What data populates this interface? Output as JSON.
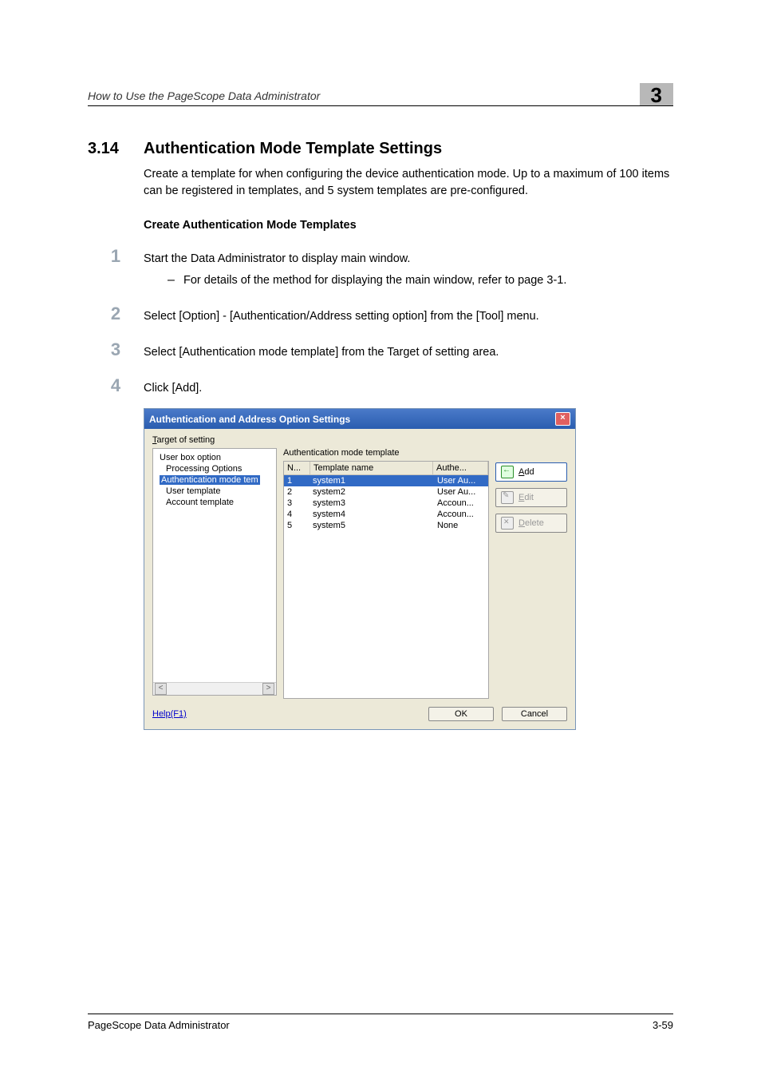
{
  "header": {
    "running_head": "How to Use the PageScope Data Administrator",
    "chapter_number": "3"
  },
  "section": {
    "number": "3.14",
    "title": "Authentication Mode Template Settings",
    "intro": "Create a template for when configuring the device authentication mode. Up to a maximum of 100 items can be registered in templates, and 5 system templates are pre-configured.",
    "sub_heading": "Create Authentication Mode Templates",
    "steps": [
      {
        "num": "1",
        "text": "Start the Data Administrator to display main window.",
        "sub": "For details of the method for displaying the main window, refer to page 3-1."
      },
      {
        "num": "2",
        "text": "Select [Option] - [Authentication/Address setting option] from the [Tool] menu."
      },
      {
        "num": "3",
        "text": "Select [Authentication mode template] from the Target of setting area."
      },
      {
        "num": "4",
        "text": "Click [Add]."
      }
    ]
  },
  "dialog": {
    "title": "Authentication and Address Option Settings",
    "target_label_prefix": "T",
    "target_label_rest": "arget of setting",
    "list_title": "Authentication mode template",
    "tree": {
      "items": [
        "User box option",
        "Processing Options",
        "Authentication mode tem",
        "User template",
        "Account template"
      ],
      "selected_index": 2
    },
    "list": {
      "headers": {
        "n": "N...",
        "template": "Template name",
        "auth": "Authe..."
      },
      "rows": [
        {
          "n": "1",
          "name": "system1",
          "auth": "User Au..."
        },
        {
          "n": "2",
          "name": "system2",
          "auth": "User Au..."
        },
        {
          "n": "3",
          "name": "system3",
          "auth": "Accoun..."
        },
        {
          "n": "4",
          "name": "system4",
          "auth": "Accoun..."
        },
        {
          "n": "5",
          "name": "system5",
          "auth": "None"
        }
      ],
      "selected_index": 0
    },
    "actions": {
      "add_u": "A",
      "add_rest": "dd",
      "edit_u": "E",
      "edit_rest": "dit",
      "delete_u": "D",
      "delete_rest": "elete"
    },
    "help": "Help(F1)",
    "ok": "OK",
    "cancel": "Cancel"
  },
  "footer": {
    "doc_title": "PageScope Data Administrator",
    "page_num": "3-59"
  }
}
